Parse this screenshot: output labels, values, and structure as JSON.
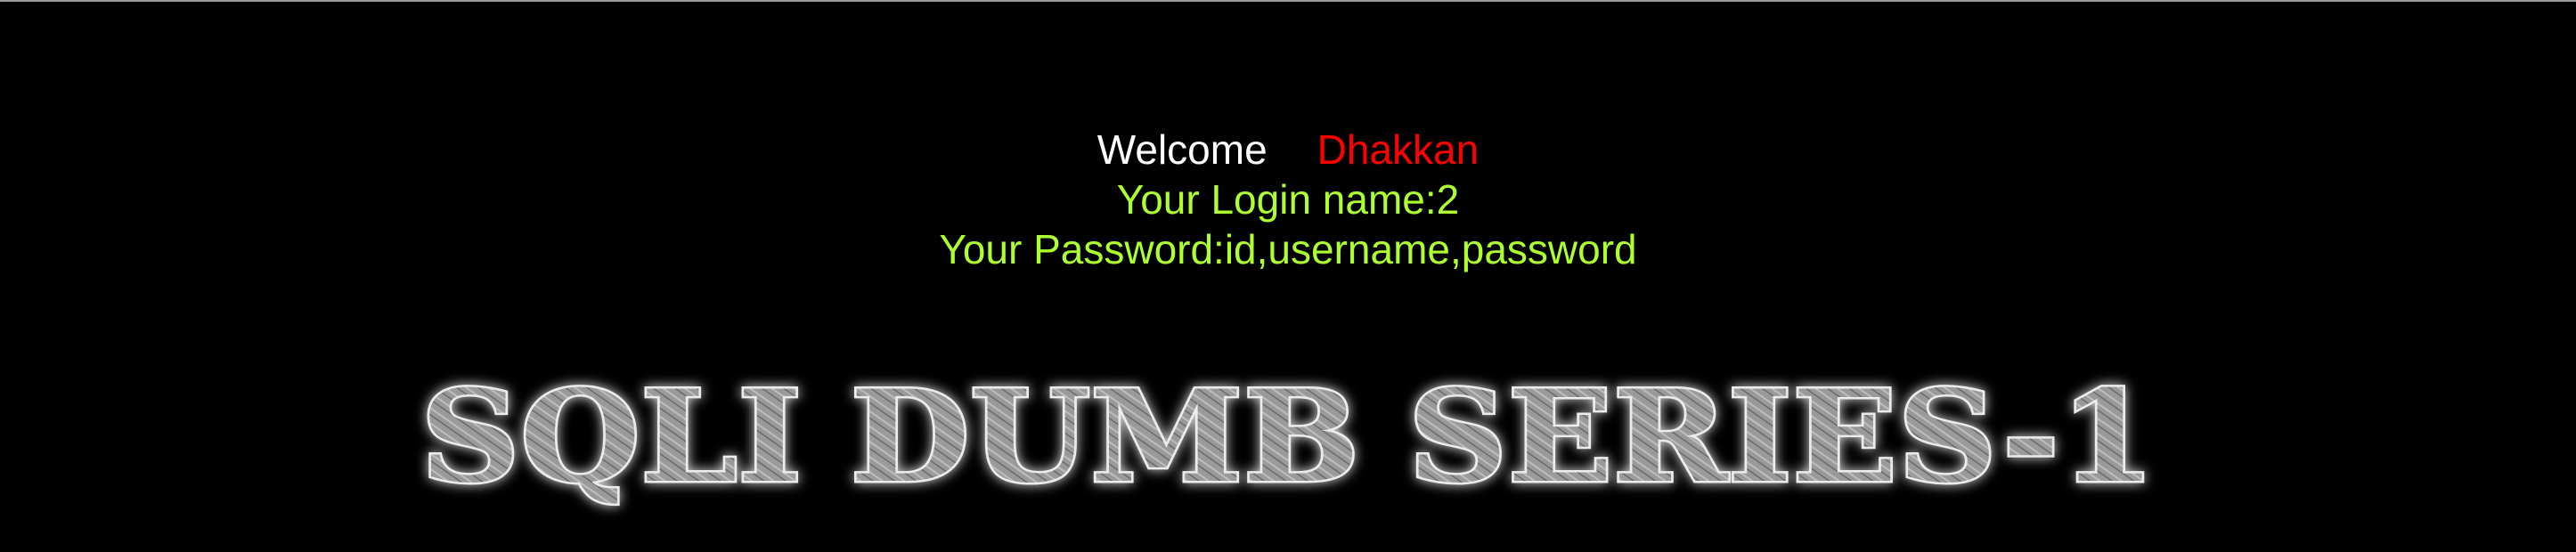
{
  "welcome": {
    "greeting": "Welcome",
    "name": "Dhakkan"
  },
  "login": {
    "login_name_text": "Your Login name:2",
    "password_text": "Your Password:id,username,password"
  },
  "banner": {
    "title": "SQLI DUMB SERIES-1"
  },
  "colors": {
    "background": "#000000",
    "greeting": "#ffffff",
    "name": "#ff0000",
    "info": "#adff2f"
  }
}
